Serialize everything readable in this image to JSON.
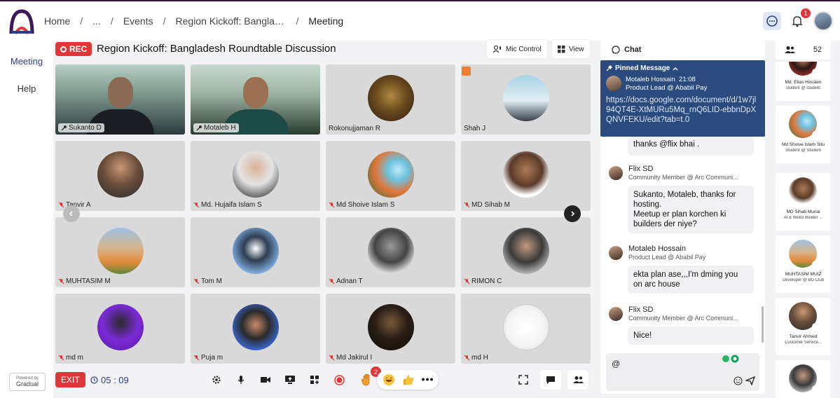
{
  "breadcrumb": {
    "home": "Home",
    "ellipsis": "...",
    "events": "Events",
    "event": "Region Kickoff: Banglades...",
    "current": "Meeting",
    "separator": "/"
  },
  "notifications": {
    "count": "1"
  },
  "nav": {
    "meeting": "Meeting",
    "help": "Help"
  },
  "powered": {
    "line1": "Powered by",
    "line2": "Gradual"
  },
  "meeting": {
    "rec_label": "REC",
    "title": "Region Kickoff: Bangladesh Roundtable Discussion",
    "mic_control": "Mic Control",
    "view": "View"
  },
  "tiles": [
    {
      "name": "Sukanto D"
    },
    {
      "name": "Motaleb H"
    },
    {
      "name": "Rokonujjaman R"
    },
    {
      "name": "Shah J"
    },
    {
      "name": "Tanvir A"
    },
    {
      "name": "Md. Hujaifa Islam S"
    },
    {
      "name": "Md Shoive Islam S"
    },
    {
      "name": "MD Sihab M"
    },
    {
      "name": "MUHTASIM M"
    },
    {
      "name": "Tom M"
    },
    {
      "name": "Adnan T"
    },
    {
      "name": "RIMON C"
    },
    {
      "name": "md m"
    },
    {
      "name": "Puja m"
    },
    {
      "name": "Md Jakirul I"
    },
    {
      "name": "md H"
    }
  ],
  "controls": {
    "exit": "EXIT",
    "timer": "05 : 09",
    "hand_count": "2"
  },
  "chat": {
    "title": "Chat",
    "pinned_label": "Pinned Message",
    "pinned_sender": "Motaleb Hossain",
    "pinned_time": "21:08",
    "pinned_role": "Product Lead @ Ababil Pay",
    "pinned_text": "https://docs.google.com/document/d/1w7jl94QT4E-XtMURu5Mq_rnQ6LID-ebbnDpXQNVFEKU/edit?tab=t.0",
    "messages": [
      {
        "text": "thanks @flix bhai ."
      },
      {
        "sender": "Flix SD",
        "role": "Community Member @ Arc Communi...",
        "text": "Sukanto, Motaleb, thanks for hosting.\nMeetup er plan korchen ki builders der niye?"
      },
      {
        "sender": "Motaleb Hossain",
        "role": "Product Lead @ Ababil Pay",
        "text": "ekta plan ase,,,I'm dming you on arc house"
      },
      {
        "sender": "Flix SD",
        "role": "Community Member @ Arc Communi...",
        "text": "Nice!"
      }
    ],
    "composer_value": "@"
  },
  "participants": {
    "count": "52",
    "list": [
      {
        "name": "Md. Elias Hossien",
        "role": "student @ student"
      },
      {
        "name": "Md Shoive Islam Situ",
        "role": "Student @ Student"
      },
      {
        "name": "MD Sihab Munai",
        "role": "AI & Web3 Builder ..."
      },
      {
        "name": "MUHTASIM MUIZ",
        "role": "Developer @ BD Club"
      },
      {
        "name": "Tanvir Ahmed",
        "role": "Customer Service..."
      },
      {
        "name": "",
        "role": ""
      }
    ]
  },
  "colors": {
    "accent": "#2d3e8c",
    "rec": "#e0363a",
    "pinned_bg": "#2b4a7e"
  }
}
